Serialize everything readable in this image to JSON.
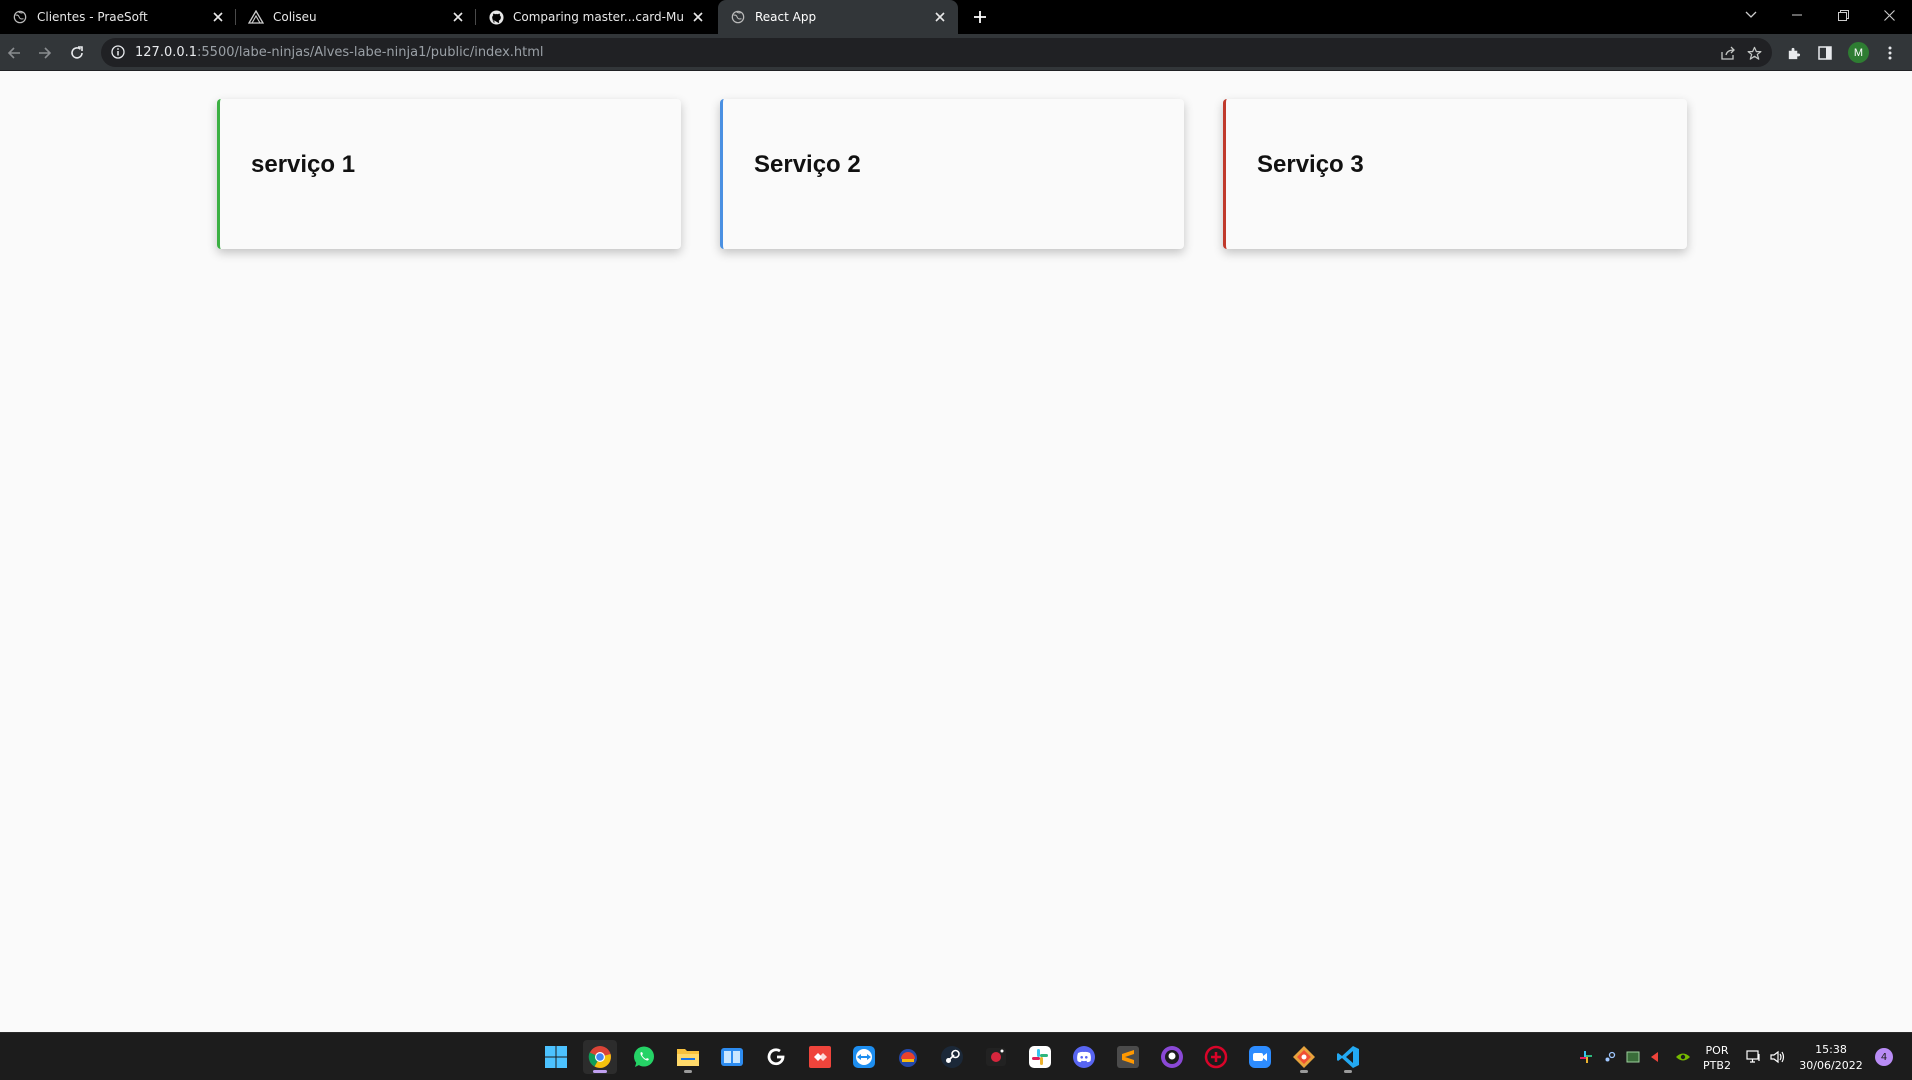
{
  "browser": {
    "tabs": [
      {
        "title": "Clientes - PraeSoft",
        "favicon": "globe-icon",
        "active": false
      },
      {
        "title": "Coliseu",
        "favicon": "coliseu-logo-icon",
        "active": false
      },
      {
        "title": "Comparing master...card-Murilo",
        "favicon": "github-icon",
        "active": false
      },
      {
        "title": "React App",
        "favicon": "globe-icon",
        "active": true
      }
    ],
    "address": {
      "host": "127.0.0.1",
      "path": ":5500/labe-ninjas/Alves-labe-ninja1/public/index.html"
    },
    "profile_initial": "M"
  },
  "page": {
    "cards": [
      {
        "title": "serviço 1",
        "accent": "#3cb043"
      },
      {
        "title": "Serviço 2",
        "accent": "#4a90e2"
      },
      {
        "title": "Serviço 3",
        "accent": "#c0392b"
      }
    ]
  },
  "taskbar": {
    "apps": [
      "windows-start-icon",
      "chrome-icon",
      "whatsapp-icon",
      "file-explorer-icon",
      "photos-icon",
      "logitech-icon",
      "anydesk-icon",
      "teamviewer-icon",
      "app-icon",
      "steam-icon",
      "recorder-icon",
      "slack-icon",
      "discord-icon",
      "sublime-text-icon",
      "github-desktop-icon",
      "antivirus-icon",
      "zoom-icon",
      "git-icon",
      "vscode-icon"
    ],
    "language": "POR",
    "layout": "PTB2",
    "time": "15:38",
    "date": "30/06/2022",
    "notifications": "4"
  }
}
